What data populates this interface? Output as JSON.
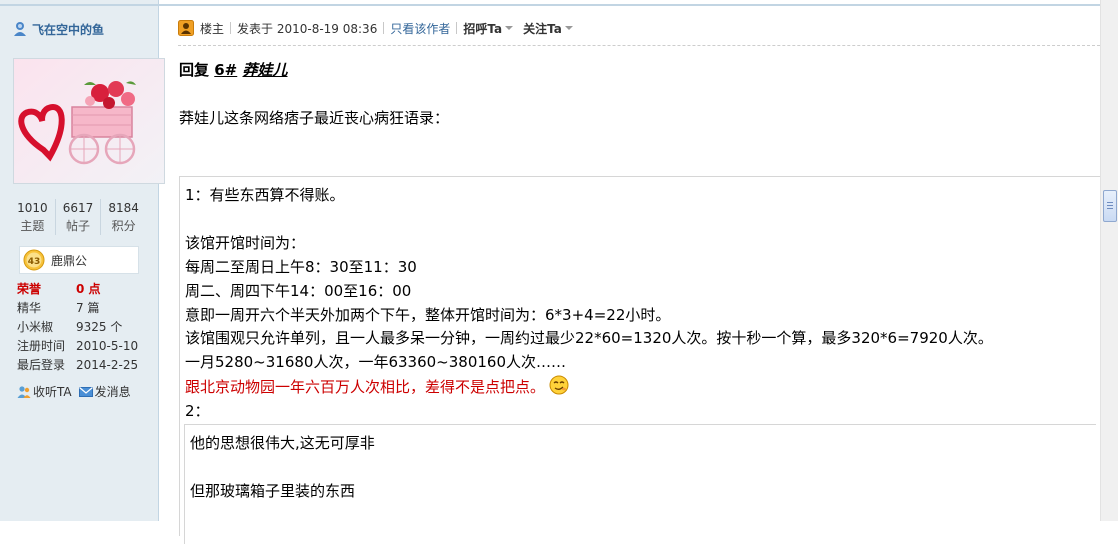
{
  "user": {
    "name": "飞在空中的鱼",
    "stats": [
      {
        "value": "1010",
        "label": "主题"
      },
      {
        "value": "6617",
        "label": "帖子"
      },
      {
        "value": "8184",
        "label": "积分"
      }
    ],
    "medal": {
      "level": "43",
      "title": "鹿鼎公"
    },
    "info": [
      {
        "key": "荣誉",
        "value": "0 点"
      },
      {
        "key": "精华",
        "value": "7 篇"
      },
      {
        "key": "小米椒",
        "value": "9325 个"
      },
      {
        "key": "注册时间",
        "value": "2010-5-10"
      },
      {
        "key": "最后登录",
        "value": "2014-2-25"
      }
    ],
    "actions": {
      "follow": "收听TA",
      "message": "发消息"
    }
  },
  "post": {
    "role": "楼主",
    "posted_at": "发表于 2010-8-19 08:36",
    "only_author": "只看该作者",
    "greet": "招呼Ta",
    "follow": "关注Ta",
    "reply_prefix": "回复",
    "reply_num": "6#",
    "reply_name": "莽娃儿",
    "intro": "莽娃儿这条网络痞子最近丧心病狂语录：",
    "quote_lines": [
      "1：有些东西算不得账。",
      "",
      "该馆开馆时间为：",
      "每周二至周日上午8：30至11：30",
      "周二、周四下午14：00至16：00",
      "意即一周开六个半天外加两个下午，整体开馆时间为：6*3+4=22小时。",
      "该馆围观只允许单列，且一人最多呆一分钟，一周约过最少22*60=1320人次。按十秒一个算，最多320*6=7920人次。",
      "一月5280~31680人次，一年63360~380160人次……"
    ],
    "quote_red_line": "跟北京动物园一年六百万人次相比，差得不是点把点。",
    "quote_item2": "2：",
    "inner_quote_lines": [
      "他的思想很伟大,这无可厚非",
      "",
      "但那玻璃箱子里装的东西"
    ]
  },
  "colors": {
    "sidebar_bg": "#e5edf2",
    "link": "#336699",
    "highlight_red": "#cc0000"
  }
}
